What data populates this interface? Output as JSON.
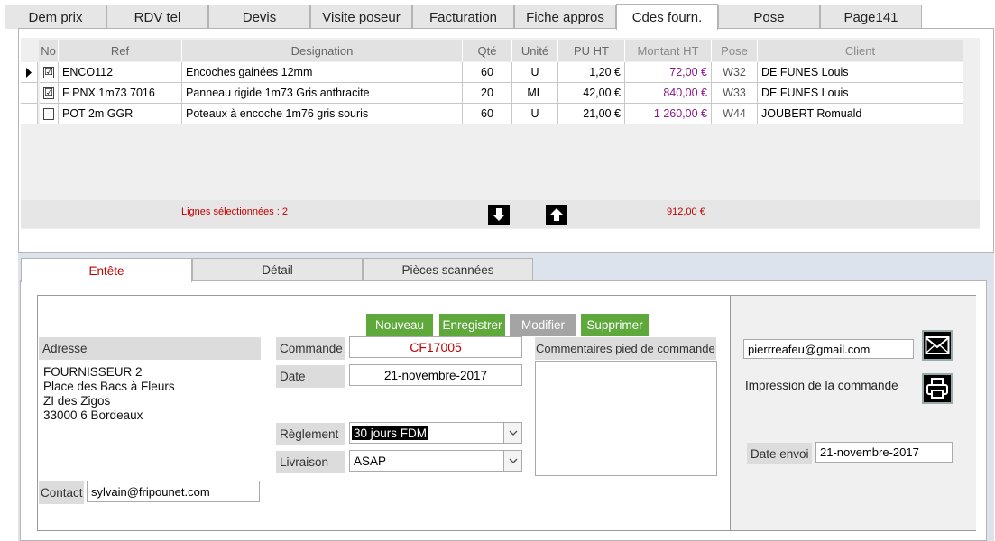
{
  "tabs": [
    "Dem prix",
    "RDV tel",
    "Devis",
    "Visite poseur",
    "Facturation",
    "Fiche appros",
    "Cdes fourn.",
    "Pose",
    "Page141"
  ],
  "grid": {
    "headers": {
      "no": "No",
      "ref": "Ref",
      "designation": "Designation",
      "qte": "Qté",
      "unite": "Unité",
      "pu_ht": "PU HT",
      "montant_ht": "Montant HT",
      "pose": "Pose",
      "client": "Client"
    },
    "rows": [
      {
        "checked": "☑",
        "ref": "ENCO112",
        "designation": "Encoches gainées 12mm",
        "qte": "60",
        "unite": "U",
        "pu_ht": "1,20 €",
        "montant_ht": "72,00 €",
        "pose": "W32",
        "client": "DE FUNES Louis"
      },
      {
        "checked": "☑",
        "ref": "F PNX 1m73 7016",
        "designation": "Panneau rigide 1m73 Gris anthracite",
        "qte": "20",
        "unite": "ML",
        "pu_ht": "42,00 €",
        "montant_ht": "840,00 €",
        "pose": "W33",
        "client": "DE FUNES Louis"
      },
      {
        "checked": "",
        "ref": "POT 2m GGR",
        "designation": "Poteaux à encoche 1m76 gris souris",
        "qte": "60",
        "unite": "U",
        "pu_ht": "21,00 €",
        "montant_ht": "1 260,00 €",
        "pose": "W44",
        "client": "JOUBERT Romuald"
      }
    ],
    "footer": {
      "selected_lines": "Lignes sélectionnées : 2",
      "total": "912,00 €"
    }
  },
  "subtabs": [
    "Entête",
    "Détail",
    "Pièces scannées"
  ],
  "form": {
    "buttons": {
      "nouveau": "Nouveau",
      "enregistrer": "Enregistrer",
      "modifier": "Modifier",
      "supprimer": "Supprimer"
    },
    "adresse_label": "Adresse",
    "adresse_lines": [
      "FOURNISSEUR 2",
      "Place des Bacs à Fleurs",
      "ZI des Zigos",
      "33000 6 Bordeaux"
    ],
    "contact_label": "Contact",
    "contact_value": "sylvain@fripounet.com",
    "commande_label": "Commande",
    "commande_value": "CF17005",
    "date_label": "Date",
    "date_value": "21-novembre-2017",
    "reglement_label": "Règlement",
    "reglement_value": "30 jours FDM",
    "livraison_label": "Livraison",
    "livraison_value": "ASAP",
    "commentaires_label": "Commentaires pied de commande",
    "email_value": "pierrreafeu@gmail.com",
    "impression_label": "Impression de la commande",
    "date_envoi_label": "Date envoi",
    "date_envoi_value": "21-novembre-2017"
  },
  "colors": {
    "accent_red": "#c00000",
    "button_green": "#5ea83c",
    "amount_purple": "#8b1a8b"
  }
}
